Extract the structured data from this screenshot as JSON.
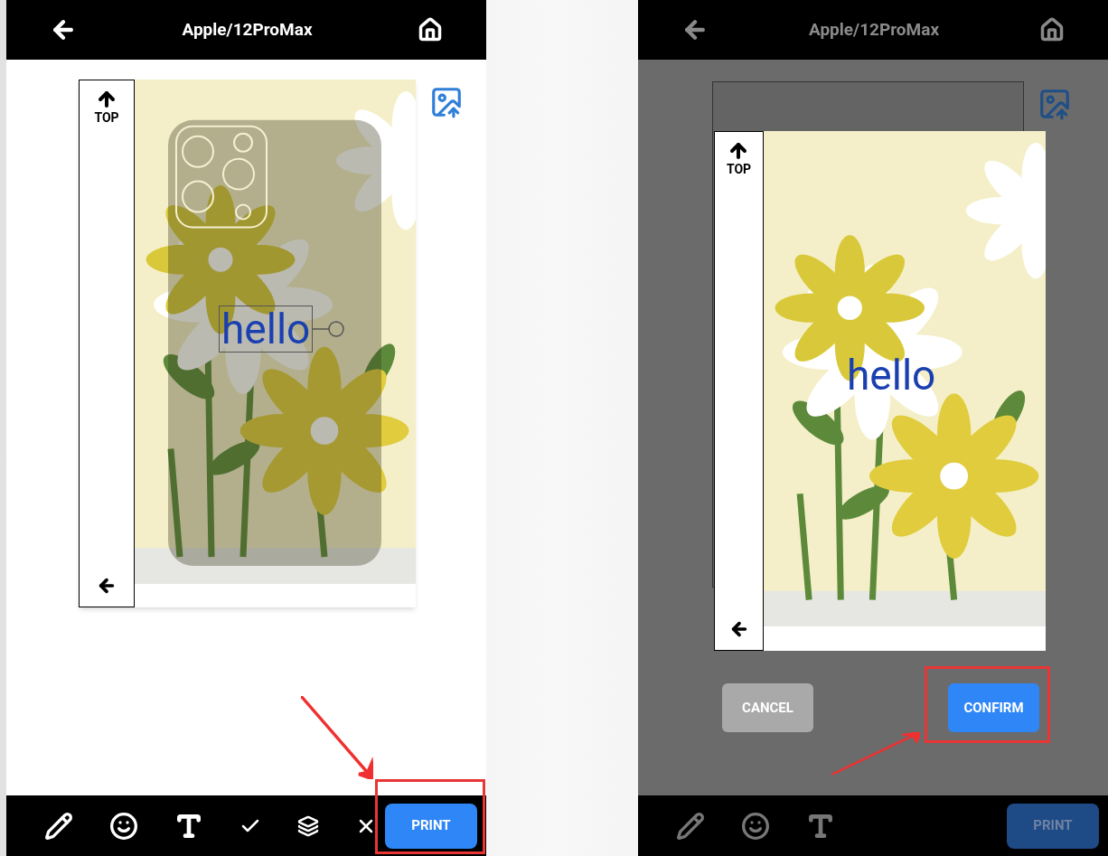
{
  "screens": [
    {
      "dimmed": false,
      "header": {
        "title": "Apple/12ProMax"
      },
      "canvas": {
        "top_label": "TOP",
        "text_layer": "hello",
        "text_selected": true,
        "phone_outline": true
      },
      "toolbar": {
        "tools": [
          {
            "kind": "pen"
          },
          {
            "kind": "emoji"
          },
          {
            "kind": "text"
          },
          {
            "kind": "apply"
          },
          {
            "kind": "layers"
          },
          {
            "kind": "delete"
          }
        ],
        "print_button": {
          "label": "PRINT"
        }
      },
      "annotation": {
        "kind": "toolbar"
      }
    },
    {
      "dimmed": true,
      "header": {
        "title": "Apple/12ProMax"
      },
      "dialog": {
        "top_label": "TOP",
        "text_layer": "hello",
        "buttons": [
          {
            "label": "CANCEL",
            "kind": "secondary"
          },
          {
            "label": "CONFIRM",
            "kind": "primary"
          }
        ]
      },
      "toolbar": {
        "tools": [
          {
            "kind": "pen"
          },
          {
            "kind": "emoji"
          },
          {
            "kind": "text"
          }
        ],
        "print_button": {
          "label": "PRINT"
        }
      },
      "annotation": {
        "kind": "dialog"
      }
    }
  ]
}
